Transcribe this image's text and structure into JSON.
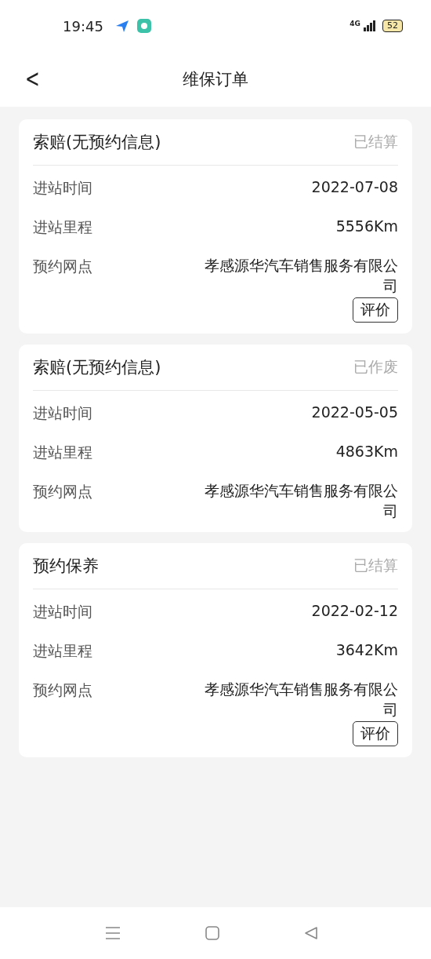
{
  "status_bar": {
    "time": "19:45",
    "network": "4G",
    "battery": "52"
  },
  "header": {
    "back": "<",
    "title": "维保订单"
  },
  "orders": [
    {
      "title": "索赔(无预约信息)",
      "status": "已结算",
      "fields": [
        {
          "label": "进站时间",
          "value": "2022-07-08"
        },
        {
          "label": "进站里程",
          "value": "5556Km"
        },
        {
          "label": "预约网点",
          "value": "孝感源华汽车销售服务有限公司"
        }
      ],
      "button": "评价"
    },
    {
      "title": "索赔(无预约信息)",
      "status": "已作废",
      "fields": [
        {
          "label": "进站时间",
          "value": "2022-05-05"
        },
        {
          "label": "进站里程",
          "value": "4863Km"
        },
        {
          "label": "预约网点",
          "value": "孝感源华汽车销售服务有限公司"
        }
      ]
    },
    {
      "title": "预约保养",
      "status": "已结算",
      "fields": [
        {
          "label": "进站时间",
          "value": "2022-02-12"
        },
        {
          "label": "进站里程",
          "value": "3642Km"
        },
        {
          "label": "预约网点",
          "value": "孝感源华汽车销售服务有限公司"
        }
      ],
      "button": "评价"
    }
  ]
}
